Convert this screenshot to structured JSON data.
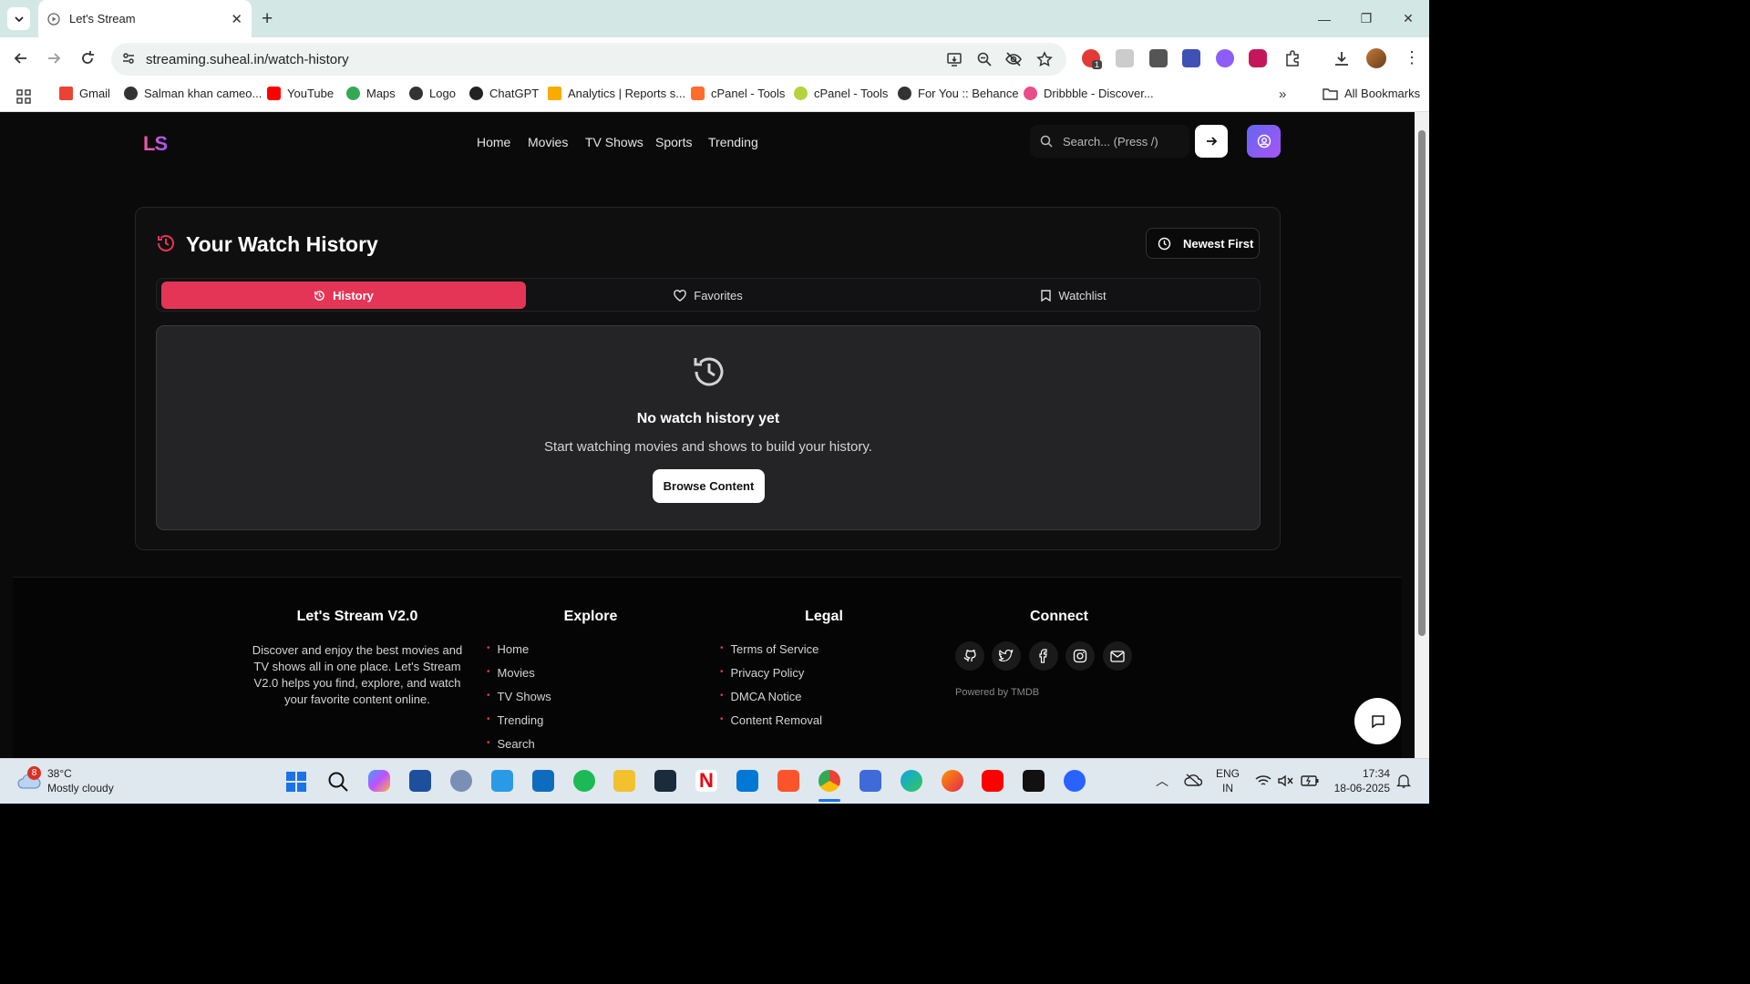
{
  "browser": {
    "tab_title": "Let's Stream",
    "url": "streaming.suheal.in/watch-history",
    "bookmarks": [
      "Gmail",
      "Salman khan cameo...",
      "YouTube",
      "Maps",
      "Logo",
      "ChatGPT",
      "Analytics | Reports s...",
      "cPanel - Tools",
      "cPanel - Tools",
      "For You :: Behance",
      "Dribbble - Discover..."
    ],
    "all_bookmarks": "All Bookmarks",
    "ext_badge": "1"
  },
  "site": {
    "logo": "LS",
    "nav": [
      "Home",
      "Movies",
      "TV Shows",
      "Sports",
      "Trending"
    ],
    "search_placeholder": "Search... (Press /)"
  },
  "history": {
    "title": "Your Watch History",
    "sort_label": "Newest First",
    "tabs": [
      "History",
      "Favorites",
      "Watchlist"
    ],
    "empty_title": "No watch history yet",
    "empty_text": "Start watching movies and shows to build your history.",
    "browse_label": "Browse Content"
  },
  "footer": {
    "brand_title": "Let's Stream V2.0",
    "brand_desc": "Discover and enjoy the best movies and TV shows all in one place. Let's Stream V2.0 helps you find, explore, and watch your favorite content online.",
    "explore_title": "Explore",
    "explore_links": [
      "Home",
      "Movies",
      "TV Shows",
      "Trending",
      "Search"
    ],
    "legal_title": "Legal",
    "legal_links": [
      "Terms of Service",
      "Privacy Policy",
      "DMCA Notice",
      "Content Removal"
    ],
    "connect_title": "Connect",
    "social_icons": [
      "github-icon",
      "twitter-icon",
      "facebook-icon",
      "instagram-icon",
      "mail-icon"
    ],
    "powered_by": "Powered by TMDB"
  },
  "taskbar": {
    "weather_badge": "8",
    "temp": "38°C",
    "condition": "Mostly cloudy",
    "lang1": "ENG",
    "lang2": "IN",
    "time": "17:34",
    "date": "18-06-2025"
  },
  "colors": {
    "accent": "#e53557",
    "profile_gradient_start": "#6366f1",
    "profile_gradient_end": "#a855f7",
    "page_bg": "#0a0a0b"
  }
}
